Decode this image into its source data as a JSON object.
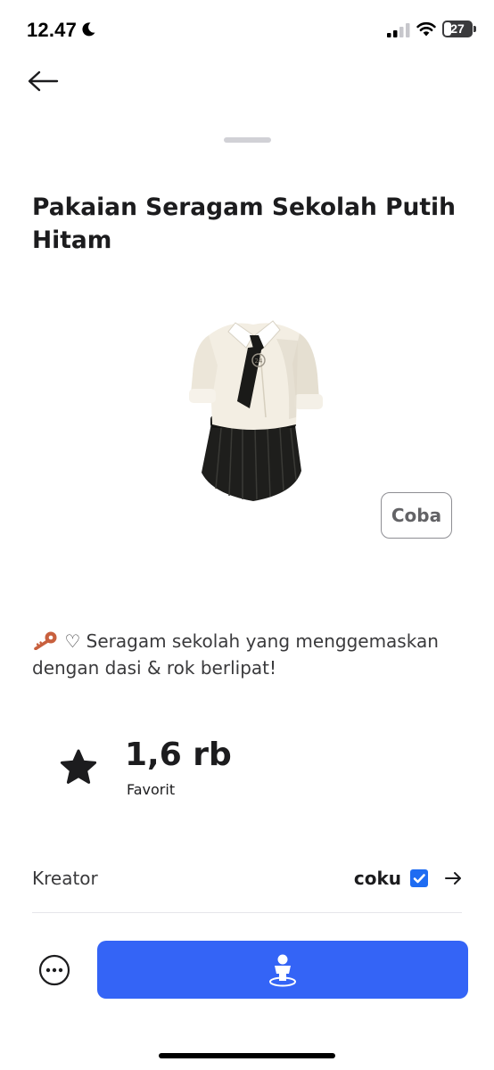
{
  "status_bar": {
    "time": "12.47",
    "battery_level": "27",
    "icons": [
      "moon-icon",
      "signal-icon",
      "wifi-icon",
      "battery-icon"
    ]
  },
  "nav": {
    "back_icon": "arrow-left-icon"
  },
  "item": {
    "title": "Pakaian Seragam Sekolah Putih Hitam",
    "image_icon": "school-uniform-image",
    "try_label": "Coba",
    "description": "♡ Seragam sekolah yang menggemaskan dengan dasi & rok berlipat!",
    "description_icon": "key-icon"
  },
  "favorites": {
    "count": "1,6 rb",
    "label": "Favorit",
    "icon": "star-icon"
  },
  "creator": {
    "label": "Kreator",
    "name": "coku",
    "verified_icon": "verified-badge-icon",
    "arrow_icon": "arrow-right-icon"
  },
  "actions": {
    "more_icon": "more-options-icon",
    "primary_icon": "avatar-try-on-icon"
  },
  "colors": {
    "primary_button": "#3464f6",
    "verified_badge": "#1e6cf2",
    "key": "#c8603e",
    "text_dark": "#1c1c1e"
  }
}
